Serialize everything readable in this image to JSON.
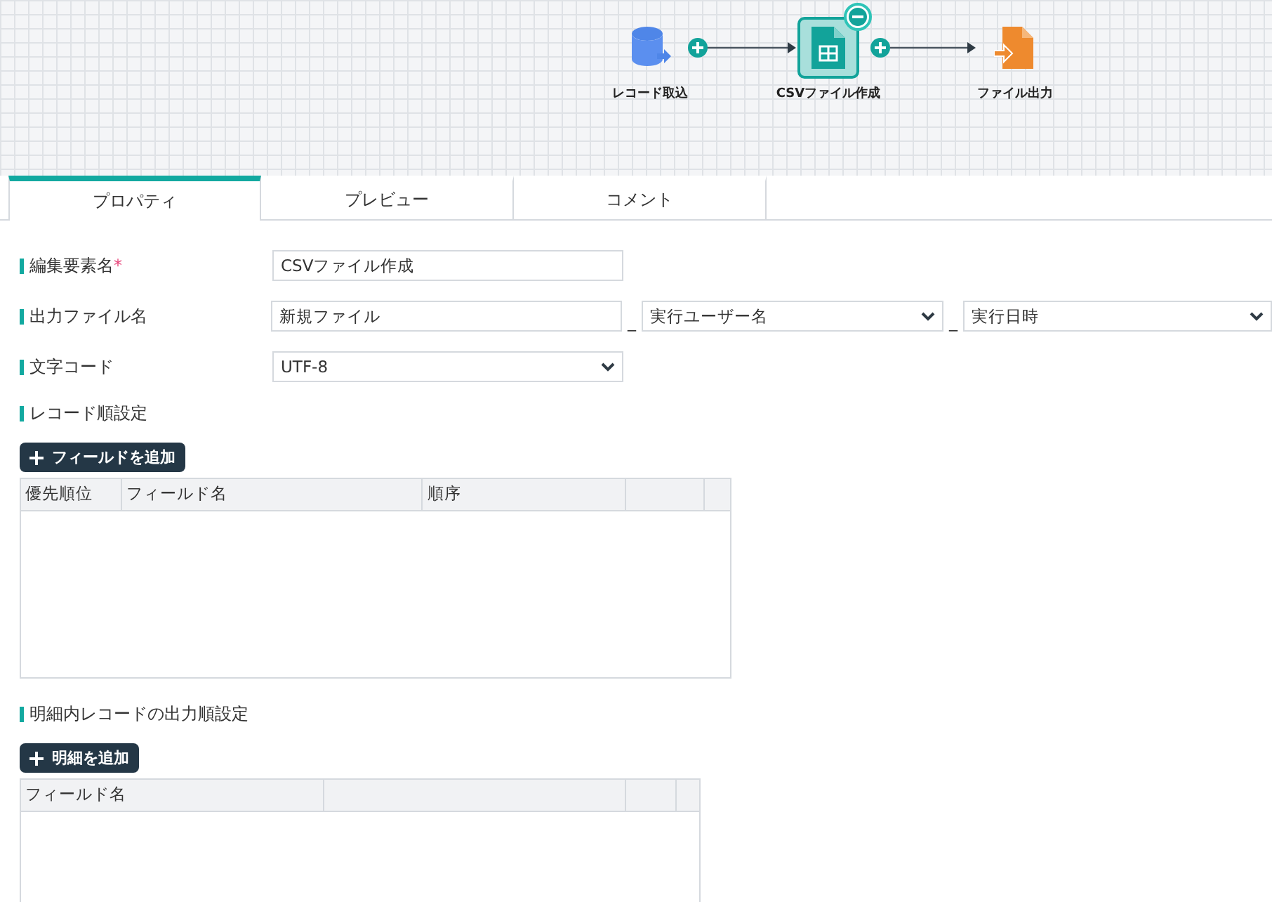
{
  "flow": {
    "nodes": [
      {
        "label": "レコード取込",
        "kind": "database",
        "selected": false
      },
      {
        "label": "CSVファイル作成",
        "kind": "sheet",
        "selected": true
      },
      {
        "label": "ファイル出力",
        "kind": "export",
        "selected": false
      }
    ]
  },
  "tabs": [
    {
      "label": "プロパティ",
      "selected": true
    },
    {
      "label": "プレビュー",
      "selected": false
    },
    {
      "label": "コメント",
      "selected": false
    }
  ],
  "fields": [
    {
      "label": "編集要素名",
      "required_mark": "*",
      "parts": [
        {
          "kind": "input",
          "value": "CSVファイル作成"
        }
      ]
    },
    {
      "label": "出力ファイル名",
      "parts": [
        {
          "kind": "input",
          "value": "新規ファイル"
        },
        {
          "kind": "sep",
          "text": "_"
        },
        {
          "kind": "select",
          "value": "実行ユーザー名"
        },
        {
          "kind": "sep",
          "text": "_"
        },
        {
          "kind": "select",
          "value": "実行日時"
        }
      ]
    },
    {
      "label": "文字コード",
      "parts": [
        {
          "kind": "select",
          "value": "UTF-8"
        }
      ]
    }
  ],
  "sections": [
    {
      "title": "レコード順設定",
      "button": "フィールドを追加",
      "columns": [
        "優先順位",
        "フィールド名",
        "順序"
      ]
    },
    {
      "title": "明細内レコードの出力順設定",
      "button": "明細を追加",
      "columns": [
        "フィールド名"
      ]
    }
  ]
}
